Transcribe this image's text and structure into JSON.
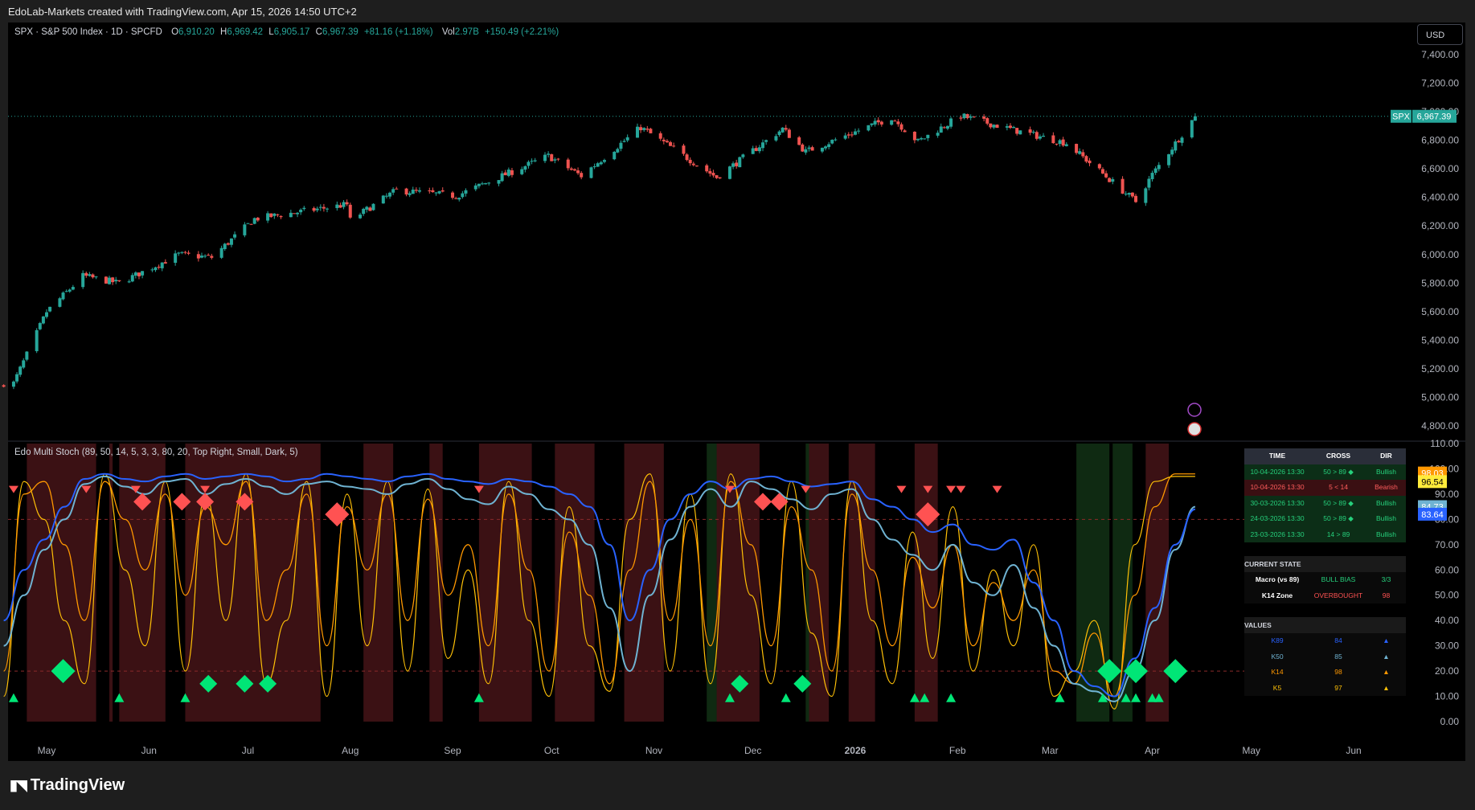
{
  "header": {
    "caption": "EdoLab-Markets created with TradingView.com, Apr 15, 2026 14:50 UTC+2"
  },
  "legend_main": {
    "symbol": "SPX · S&P 500 Index · 1D · SPCFD",
    "o_label": "O",
    "o_value": "6,910.20",
    "h_label": "H",
    "h_value": "6,969.42",
    "l_label": "L",
    "l_value": "6,905.17",
    "c_label": "C",
    "c_value": "6,967.39",
    "change": "+81.16 (+1.18%)",
    "vol_label": "Vol",
    "vol_value": "2.97B",
    "vol_change": "+150.49 (+2.21%)"
  },
  "legend_osc": {
    "title": "Edo Multi Stoch (89, 50, 14, 5, 3, 3, 80, 20, Top Right, Small, Dark, 5)"
  },
  "currency_button": "USD",
  "price_tag": {
    "symbol": "SPX",
    "value": "6,967.39"
  },
  "osc_tags": [
    {
      "value": "98.03",
      "color": "#ff9800"
    },
    {
      "value": "96.54",
      "color": "#ffeb3b"
    },
    {
      "value": "84.73",
      "color": "#6fb3d2"
    },
    {
      "value": "83.64",
      "color": "#2962ff"
    }
  ],
  "colors": {
    "up": "#26a69a",
    "down": "#ef5350",
    "k89": "#2962ff",
    "k50": "#6fb3d2",
    "k14": "#ff9800",
    "k5": "#ffc107",
    "bull_marker": "#00e676",
    "bear_marker": "#ff5252",
    "ob_zone": "#3b1114",
    "os_zone": "#0f2a12"
  },
  "table": {
    "headers": [
      "TIME",
      "CROSS",
      "DIR"
    ],
    "rows": [
      {
        "time": "10-04-2026 13:30",
        "cross": "50 > 89 ◆",
        "dir": "Bullish",
        "style": "bull"
      },
      {
        "time": "10-04-2026 13:30",
        "cross": "5 < 14",
        "dir": "Bearish",
        "style": "bear"
      },
      {
        "time": "30-03-2026 13:30",
        "cross": "50 > 89 ◆",
        "dir": "Bullish",
        "style": "bull"
      },
      {
        "time": "24-03-2026 13:30",
        "cross": "50 > 89 ◆",
        "dir": "Bullish",
        "style": "bull"
      },
      {
        "time": "23-03-2026 13:30",
        "cross": "14 > 89",
        "dir": "Bullish",
        "style": "bull"
      }
    ],
    "state_title": "CURRENT STATE",
    "state": [
      {
        "label": "Macro (vs 89)",
        "value": "BULL BIAS",
        "extra": "3/3",
        "vcolor": "#26d07c",
        "ecolor": "#26d07c"
      },
      {
        "label": "K14 Zone",
        "value": "OVERBOUGHT",
        "extra": "98",
        "vcolor": "#ff5252",
        "ecolor": "#ff5252"
      }
    ],
    "values_title": "VALUES",
    "values": [
      {
        "label": "K89",
        "value": "84",
        "arrow": "▲",
        "color": "#2962ff"
      },
      {
        "label": "K50",
        "value": "85",
        "arrow": "▲",
        "color": "#6fb3d2"
      },
      {
        "label": "K14",
        "value": "98",
        "arrow": "▲",
        "color": "#ff9800"
      },
      {
        "label": "K5",
        "value": "97",
        "arrow": "▲",
        "color": "#ffc107"
      }
    ]
  },
  "chart_data": [
    {
      "type": "candlestick",
      "title": "SPX · S&P 500 Index · 1D · SPCFD",
      "ylim": [
        4700,
        7500
      ],
      "y_ticks": [
        "7,400.00",
        "7,200.00",
        "7,000.00",
        "6,800.00",
        "6,600.00",
        "6,400.00",
        "6,200.00",
        "6,000.00",
        "5,800.00",
        "5,600.00",
        "5,400.00",
        "5,200.00",
        "5,000.00",
        "4,800.00"
      ],
      "x_ticks": [
        "May",
        "Jun",
        "Jul",
        "Aug",
        "Sep",
        "Oct",
        "Nov",
        "Dec",
        "2026",
        "Feb",
        "Mar",
        "Apr",
        "May",
        "Jun"
      ],
      "last_close": 6967.39,
      "trend_path": [
        [
          "2025-04-21",
          5100
        ],
        [
          "2025-05-01",
          5600
        ],
        [
          "2025-05-12",
          5850
        ],
        [
          "2025-05-23",
          5800
        ],
        [
          "2025-06-10",
          6000
        ],
        [
          "2025-06-20",
          5980
        ],
        [
          "2025-07-03",
          6250
        ],
        [
          "2025-07-31",
          6350
        ],
        [
          "2025-08-01",
          6240
        ],
        [
          "2025-08-15",
          6450
        ],
        [
          "2025-09-02",
          6410
        ],
        [
          "2025-09-30",
          6690
        ],
        [
          "2025-10-10",
          6550
        ],
        [
          "2025-10-28",
          6890
        ],
        [
          "2025-11-20",
          6540
        ],
        [
          "2025-12-10",
          6880
        ],
        [
          "2025-12-17",
          6720
        ],
        [
          "2026-01-12",
          6960
        ],
        [
          "2026-01-20",
          6790
        ],
        [
          "2026-02-02",
          6970
        ],
        [
          "2026-02-20",
          6860
        ],
        [
          "2026-03-06",
          6780
        ],
        [
          "2026-03-27",
          6370
        ],
        [
          "2026-04-01",
          6560
        ],
        [
          "2026-04-14",
          6967.39
        ]
      ]
    },
    {
      "type": "line",
      "title": "Edo Multi Stoch (89, 50, 14, 5, 3, 3, 80, 20, Top Right, Small, Dark, 5)",
      "ylim": [
        0,
        110
      ],
      "y_ticks": [
        "110.00",
        "100.00",
        "90.00",
        "80.00",
        "70.00",
        "60.00",
        "50.00",
        "40.00",
        "30.00",
        "20.00",
        "10.00",
        "0.00"
      ],
      "levels": [
        80,
        20
      ],
      "series": [
        {
          "name": "K89",
          "last": 83.64,
          "values": [
            40,
            60,
            72,
            85,
            96,
            98,
            96,
            95,
            97,
            98,
            96,
            97,
            98,
            97,
            95,
            96,
            98,
            97,
            96,
            95,
            97,
            98,
            96,
            95,
            94,
            96,
            95,
            93,
            90,
            85,
            70,
            40,
            60,
            80,
            90,
            95,
            92,
            96,
            97,
            95,
            93,
            94,
            95,
            88,
            85,
            80,
            75,
            78,
            70,
            68,
            72,
            55,
            40,
            20,
            14,
            10,
            25,
            45,
            70,
            84
          ]
        },
        {
          "name": "K50",
          "last": 84.73,
          "values": [
            30,
            50,
            68,
            80,
            94,
            97,
            93,
            90,
            95,
            96,
            90,
            94,
            96,
            93,
            90,
            94,
            95,
            93,
            92,
            90,
            94,
            96,
            92,
            88,
            86,
            93,
            90,
            84,
            80,
            70,
            45,
            20,
            50,
            72,
            85,
            92,
            85,
            95,
            92,
            88,
            84,
            90,
            92,
            80,
            72,
            66,
            60,
            70,
            55,
            50,
            62,
            45,
            30,
            15,
            12,
            8,
            20,
            40,
            68,
            85
          ]
        },
        {
          "name": "K14",
          "last": 98.03,
          "values": [
            20,
            90,
            95,
            70,
            40,
            95,
            80,
            60,
            90,
            50,
            85,
            70,
            95,
            40,
            60,
            90,
            30,
            85,
            60,
            90,
            40,
            88,
            50,
            70,
            30,
            90,
            60,
            20,
            75,
            50,
            15,
            60,
            95,
            40,
            80,
            30,
            95,
            70,
            30,
            85,
            60,
            20,
            90,
            60,
            30,
            65,
            45,
            70,
            30,
            55,
            40,
            60,
            20,
            15,
            35,
            10,
            50,
            85,
            98,
            98
          ]
        },
        {
          "name": "K5",
          "last": 96.54,
          "values": [
            10,
            95,
            80,
            40,
            15,
            98,
            60,
            30,
            95,
            20,
            90,
            40,
            98,
            15,
            40,
            95,
            10,
            90,
            30,
            95,
            20,
            92,
            25,
            60,
            15,
            95,
            40,
            10,
            85,
            30,
            12,
            80,
            98,
            20,
            90,
            15,
            98,
            50,
            15,
            95,
            35,
            10,
            95,
            40,
            15,
            75,
            25,
            85,
            20,
            60,
            30,
            70,
            10,
            20,
            40,
            5,
            70,
            95,
            97,
            97
          ]
        }
      ]
    }
  ]
}
